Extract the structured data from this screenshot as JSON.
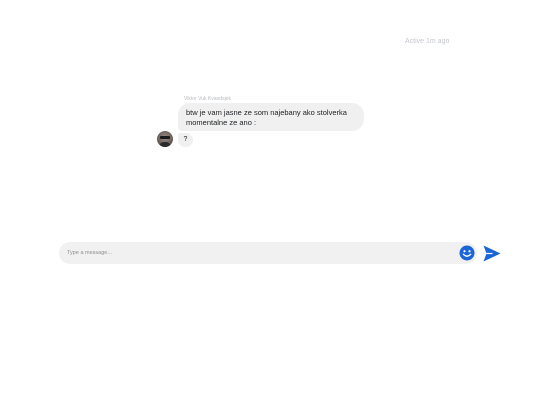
{
  "header": {
    "status": "Active 1m ago"
  },
  "conversation": {
    "sender_name": "Viktor Vuk Kvandsjek",
    "messages": [
      {
        "text": "btw je vam jasne ze som najebany ako stolverka momentalne ze ano :"
      },
      {
        "text": "?"
      }
    ]
  },
  "composer": {
    "placeholder": "Type a message...",
    "value": "",
    "emoji_icon": "smiley-face-icon",
    "send_icon": "paper-plane-send-icon"
  },
  "colors": {
    "accent": "#1a66d6",
    "bubble": "#f0f0f0",
    "composer_bg": "#f1f1f1"
  }
}
